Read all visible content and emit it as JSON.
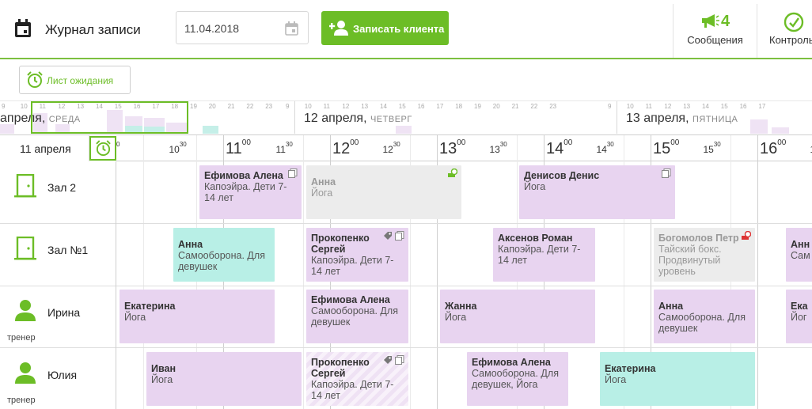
{
  "header": {
    "title": "Журнал записи",
    "date_value": "11.04.2018",
    "add_client_label": "Записать клиента",
    "messages_count": "4",
    "messages_label": "Сообщения",
    "control_label": "Контроль"
  },
  "waiting_list_label": "Лист ожидания",
  "mini_timeline": {
    "hours": [
      "9",
      "10",
      "11",
      "12",
      "13",
      "14",
      "15",
      "16",
      "17",
      "18",
      "19",
      "20",
      "21",
      "22",
      "23",
      "9",
      "10",
      "11",
      "12",
      "13",
      "14",
      "15",
      "16",
      "17",
      "18",
      "19",
      "20",
      "21",
      "22",
      "23",
      "9",
      "10",
      "11",
      "12",
      "13",
      "14",
      "15",
      "16",
      "17"
    ],
    "days": [
      {
        "date": "апреля,",
        "weekday": "СРЕДА"
      },
      {
        "date": "12 апреля,",
        "weekday": "ЧЕТВЕРГ"
      },
      {
        "date": "13 апреля,",
        "weekday": "ПЯТНИЦА"
      }
    ]
  },
  "grid": {
    "date_label": "11 апреля",
    "times": [
      {
        "h": "",
        "m": "0",
        "kind": "small"
      },
      {
        "h": "10",
        "m": "30",
        "kind": "small"
      },
      {
        "h": "11",
        "m": "00",
        "kind": "big"
      },
      {
        "h": "11",
        "m": "30",
        "kind": "small"
      },
      {
        "h": "12",
        "m": "00",
        "kind": "big"
      },
      {
        "h": "12",
        "m": "30",
        "kind": "small"
      },
      {
        "h": "13",
        "m": "00",
        "kind": "big"
      },
      {
        "h": "13",
        "m": "30",
        "kind": "small"
      },
      {
        "h": "14",
        "m": "00",
        "kind": "big"
      },
      {
        "h": "14",
        "m": "30",
        "kind": "small"
      },
      {
        "h": "15",
        "m": "00",
        "kind": "big"
      },
      {
        "h": "15",
        "m": "30",
        "kind": "small"
      },
      {
        "h": "16",
        "m": "00",
        "kind": "big"
      },
      {
        "h": "16",
        "m": "30",
        "kind": "small"
      }
    ],
    "resources": [
      {
        "name": "Зал 2",
        "role": "",
        "type": "room"
      },
      {
        "name": "Зал №1",
        "role": "",
        "type": "room"
      },
      {
        "name": "Ирина",
        "role": "тренер",
        "type": "person"
      },
      {
        "name": "Юлия",
        "role": "тренер",
        "type": "person"
      }
    ],
    "appointments": [
      {
        "name": "Ефимова Алена",
        "service": "Капоэйра. Дети 7-14 лет",
        "style": "purple",
        "badges": [
          "copy"
        ]
      },
      {
        "name": "Анна",
        "service": "Йога",
        "style": "grey",
        "badges": [
          "cash"
        ]
      },
      {
        "name": "Денисов Денис",
        "service": "Йога",
        "style": "purple",
        "badges": [
          "copy"
        ]
      },
      {
        "name": "Анна",
        "service": "Самооборона. Для девушек",
        "style": "teal",
        "badges": []
      },
      {
        "name": "Прокопенко Сергей",
        "service": "Капоэйра. Дети 7-14 лет",
        "style": "purple",
        "badges": [
          "tag",
          "copy"
        ]
      },
      {
        "name": "Аксенов Роман",
        "service": "Капоэйра. Дети 7-14 лет",
        "style": "purple",
        "badges": []
      },
      {
        "name": "Богомолов Петр",
        "service": "Тайский бокс. Продвинутый уровень",
        "style": "grey",
        "badges": [
          "cash-red"
        ]
      },
      {
        "name": "Анн",
        "service": "Сам",
        "style": "purple",
        "badges": []
      },
      {
        "name": "Екатерина",
        "service": "Йога",
        "style": "purple",
        "badges": []
      },
      {
        "name": "Ефимова Алена",
        "service": "Самооборона. Для девушек",
        "style": "purple",
        "badges": []
      },
      {
        "name": "Жанна",
        "service": "Йога",
        "style": "purple",
        "badges": []
      },
      {
        "name": "Анна",
        "service": "Самооборона. Для девушек",
        "style": "purple",
        "badges": []
      },
      {
        "name": "Ека",
        "service": "Йог",
        "style": "purple",
        "badges": []
      },
      {
        "name": "Иван",
        "service": "Йога",
        "style": "purple",
        "badges": []
      },
      {
        "name": "Прокопенко Сергей",
        "service": "Капоэйра. Дети 7-14 лет",
        "style": "striped",
        "badges": [
          "tag",
          "copy"
        ]
      },
      {
        "name": "Ефимова Алена",
        "service": "Самооборона. Для девушек, Йога",
        "style": "purple",
        "badges": []
      },
      {
        "name": "Екатерина",
        "service": "Йога",
        "style": "teal",
        "badges": []
      }
    ]
  },
  "colors": {
    "accent": "#6cbd26",
    "purple": "#e8d4f0",
    "teal": "#b8efe6",
    "grey": "#ececec"
  }
}
